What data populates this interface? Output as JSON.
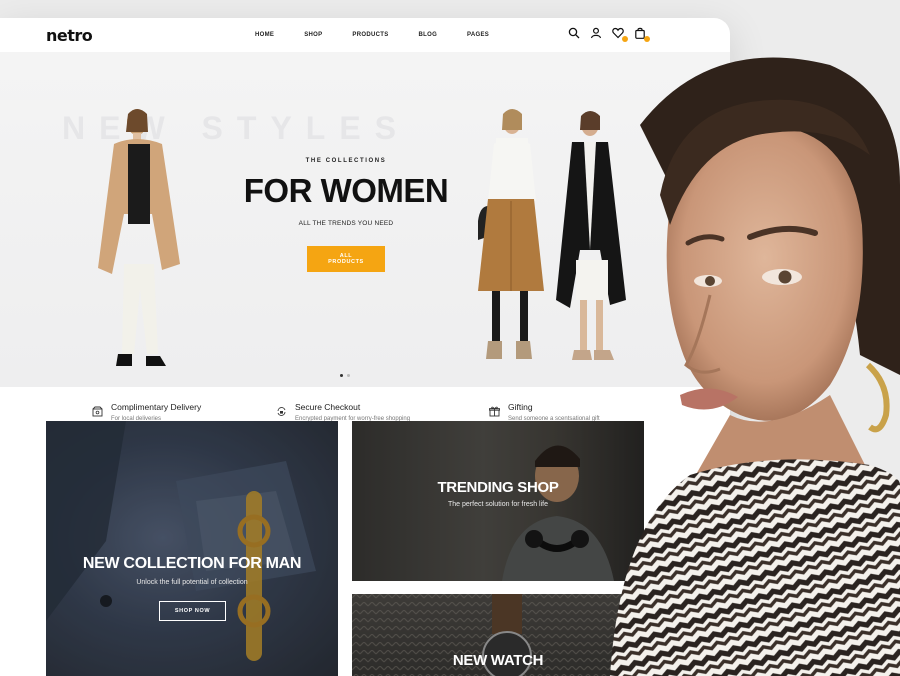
{
  "brand": {
    "logo": "netro",
    "accent": "#f5a512"
  },
  "nav": {
    "items": [
      {
        "label": "HOME"
      },
      {
        "label": "SHOP"
      },
      {
        "label": "PRODUCTS"
      },
      {
        "label": "BLOG"
      },
      {
        "label": "PAGES"
      }
    ]
  },
  "header_icons": [
    "search-icon",
    "user-icon",
    "heart-icon",
    "shopping-bag-icon"
  ],
  "hero": {
    "background_text": "NEW STYLES",
    "kicker": "THE COLLECTIONS",
    "title": "FOR WOMEN",
    "subtitle": "ALL THE TRENDS YOU NEED",
    "button_label": "ALL PRODUCTS",
    "slides": 2,
    "active_slide": 1
  },
  "features": [
    {
      "icon": "delivery-box-icon",
      "title": "Complimentary Delivery",
      "subtitle": "For local deliveries"
    },
    {
      "icon": "lock-cycle-icon",
      "title": "Secure Checkout",
      "subtitle": "Encrypted payment for worry-free shopping"
    },
    {
      "icon": "gift-icon",
      "title": "Gifting",
      "subtitle": "Send someone a scentsational gift"
    }
  ],
  "promos": {
    "man": {
      "title": "NEW COLLECTION FOR MAN",
      "subtitle": "Unlock the full potential of collection",
      "button_label": "SHOP NOW"
    },
    "trending": {
      "title": "TRENDING SHOP",
      "subtitle": "The perfect solution for fresh life"
    },
    "watch": {
      "title": "NEW WATCH"
    }
  }
}
